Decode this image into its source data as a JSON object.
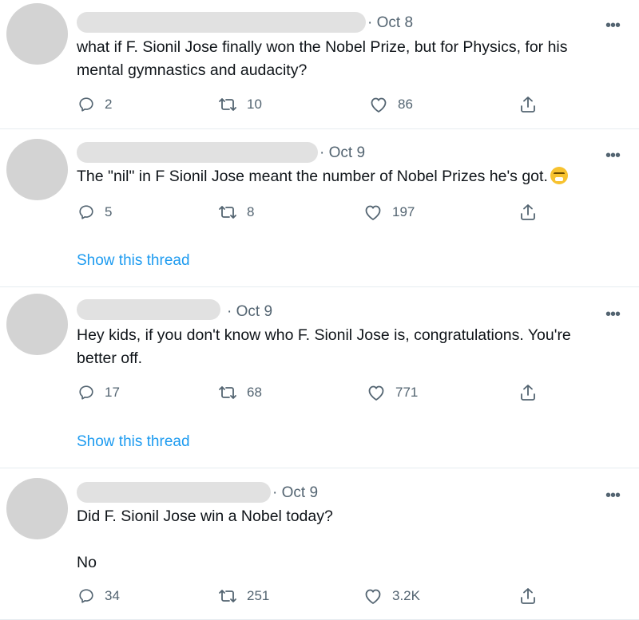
{
  "tweets": [
    {
      "time": "· Oct 8",
      "paragraphs": [
        "what if F. Sionil Jose finally won the Nobel Prize, but for Physics, for his mental gymnastics and audacity?"
      ],
      "replies": "2",
      "retweets": "10",
      "likes": "86",
      "show_thread": ""
    },
    {
      "time": "· Oct 9",
      "paragraphs": [
        "The \"nil\" in F Sionil Jose meant the number of Nobel Prizes he's got."
      ],
      "emoji": "grinning-squinting-face",
      "replies": "5",
      "retweets": "8",
      "likes": "197",
      "show_thread": "Show this thread"
    },
    {
      "time": "· Oct 9",
      "paragraphs": [
        "Hey kids, if you don't know who F. Sionil Jose is, congratulations. You're better off."
      ],
      "replies": "17",
      "retweets": "68",
      "likes": "771",
      "show_thread": "Show this thread"
    },
    {
      "time": "· Oct 9",
      "paragraphs": [
        "Did F. Sionil Jose win a Nobel today?",
        "No"
      ],
      "replies": "34",
      "retweets": "251",
      "likes": "3.2K",
      "show_thread": ""
    }
  ],
  "more_glyph": "•••",
  "icons": {
    "reply": "reply-icon",
    "retweet": "retweet-icon",
    "like": "like-icon",
    "share": "share-icon",
    "more": "more-icon"
  }
}
